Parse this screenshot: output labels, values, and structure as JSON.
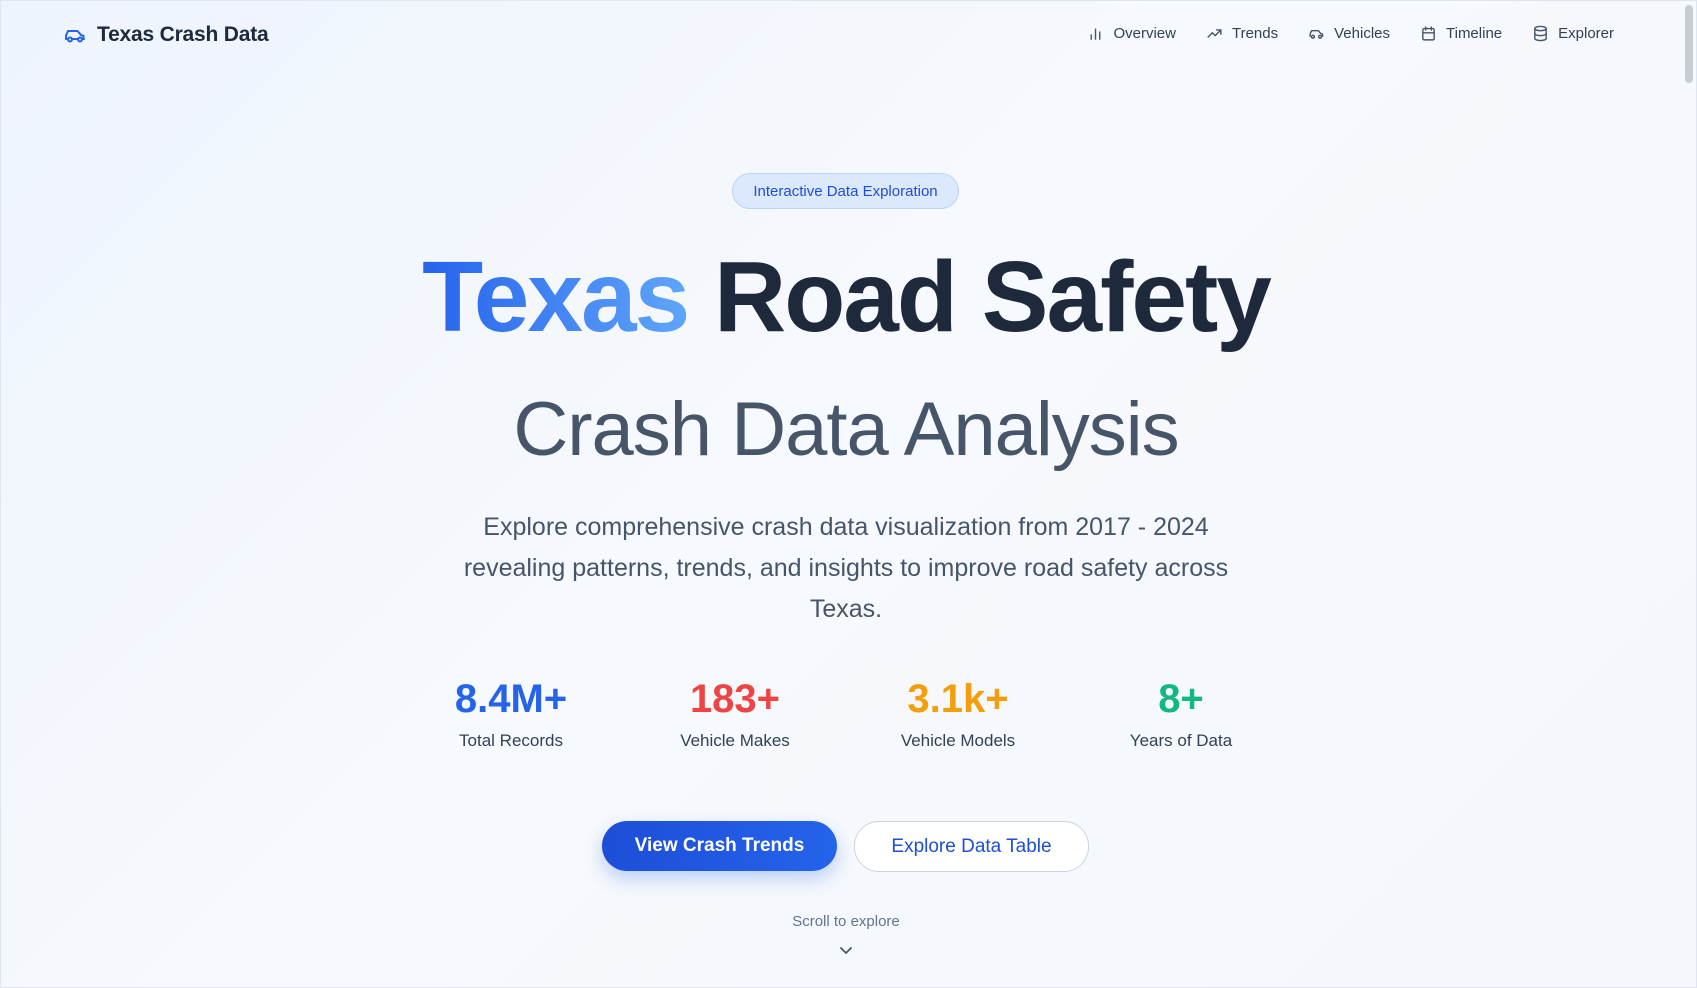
{
  "brand": {
    "name": "Texas Crash Data",
    "icon": "car-icon"
  },
  "nav": {
    "items": [
      {
        "label": "Overview",
        "icon": "bar-chart-icon"
      },
      {
        "label": "Trends",
        "icon": "trending-up-icon"
      },
      {
        "label": "Vehicles",
        "icon": "car-icon"
      },
      {
        "label": "Timeline",
        "icon": "calendar-icon"
      },
      {
        "label": "Explorer",
        "icon": "database-icon"
      }
    ]
  },
  "hero": {
    "badge": "Interactive Data Exploration",
    "title_part1": "Texas",
    "title_part2": "Road Safety",
    "subtitle": "Crash Data Analysis",
    "description": "Explore comprehensive crash data visualization from 2017 - 2024 revealing patterns, trends, and insights to improve road safety across Texas."
  },
  "stats": [
    {
      "value": "8.4M+",
      "label": "Total Records",
      "color": "#2563eb"
    },
    {
      "value": "183+",
      "label": "Vehicle Makes",
      "color": "#ef4444"
    },
    {
      "value": "3.1k+",
      "label": "Vehicle Models",
      "color": "#f59e0b"
    },
    {
      "value": "8+",
      "label": "Years of Data",
      "color": "#10b981"
    }
  ],
  "actions": {
    "primary": "View Crash Trends",
    "secondary": "Explore Data Table"
  },
  "scroll": {
    "hint": "Scroll to explore",
    "icon": "chevron-down-icon"
  },
  "colors": {
    "accent": "#2563eb",
    "heading": "#1e293b",
    "muted": "#475569"
  }
}
